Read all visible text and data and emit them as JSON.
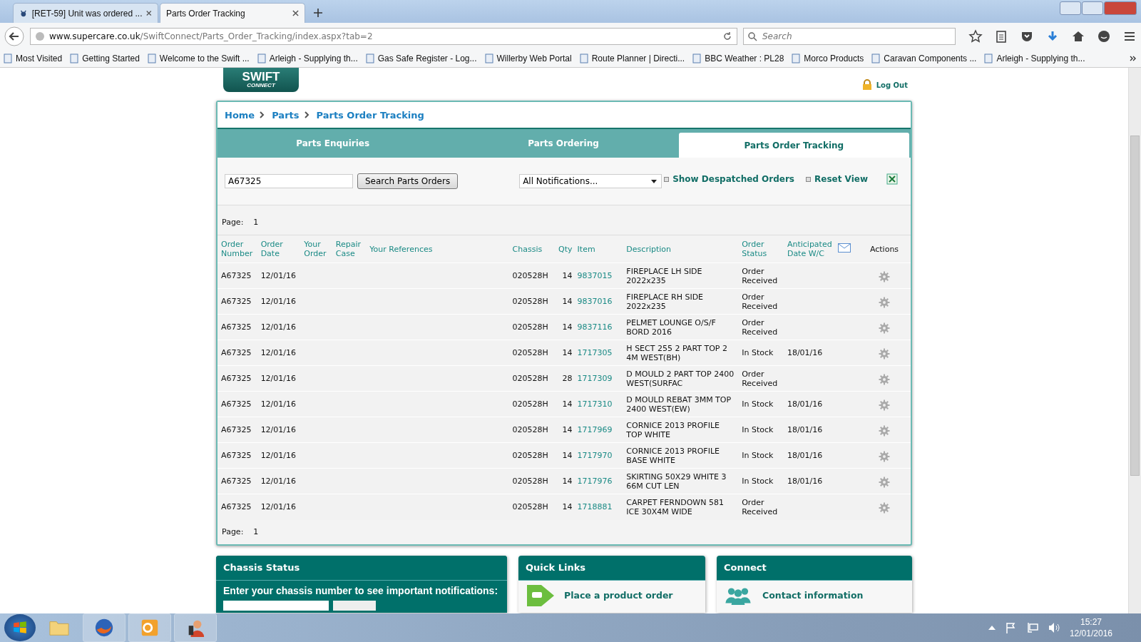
{
  "browser": {
    "tabs": [
      {
        "title": "[RET-59] Unit was ordered ...",
        "selected": false
      },
      {
        "title": "Parts Order Tracking",
        "selected": true
      }
    ],
    "url_domain": "www.supercare.co.uk",
    "url_path": "/SwiftConnect/Parts_Order_Tracking/index.aspx?tab=2",
    "search": {
      "placeholder": "Search"
    },
    "bookmarks": [
      "Most Visited",
      "Getting Started",
      "Welcome to the Swift ...",
      "Arleigh - Supplying th...",
      "Gas Safe Register - Log...",
      "Willerby Web Portal",
      "Route Planner | Directi...",
      "BBC Weather : PL28",
      "Morco Products",
      "Caravan Components ...",
      "Arleigh - Supplying th..."
    ]
  },
  "header": {
    "logo_line_1": "SWIFT",
    "logo_line_2": "CONNECT",
    "logout": "Log Out"
  },
  "breadcrumb": [
    "Home",
    "Parts",
    "Parts Order Tracking"
  ],
  "tabs": [
    {
      "label": "Parts Enquiries",
      "selected": false
    },
    {
      "label": "Parts Ordering",
      "selected": false
    },
    {
      "label": "Parts Order Tracking",
      "selected": true
    }
  ],
  "toolbar": {
    "search_value": "A67325",
    "search_button": "Search Parts Orders",
    "notifications": "All Notifications...",
    "links": [
      "Show Despatched Orders",
      "Reset View"
    ]
  },
  "page_label": "Page:",
  "page_number": "1",
  "table": {
    "columns": [
      "Order Number",
      "Order Date",
      "Your Order",
      "Repair Case",
      "Your References",
      "Chassis",
      "Qty",
      "Item",
      "Description",
      "Order Status",
      "Anticipated Date W/C",
      "Actions"
    ],
    "rows": [
      {
        "order": "A67325",
        "date": "12/01/16",
        "chassis": "020528H",
        "qty": "14",
        "item": "9837015",
        "description": "FIREPLACE LH SIDE 2022x235",
        "status": "Order Received",
        "anticipated": ""
      },
      {
        "order": "A67325",
        "date": "12/01/16",
        "chassis": "020528H",
        "qty": "14",
        "item": "9837016",
        "description": "FIREPLACE RH SIDE 2022x235",
        "status": "Order Received",
        "anticipated": ""
      },
      {
        "order": "A67325",
        "date": "12/01/16",
        "chassis": "020528H",
        "qty": "14",
        "item": "9837116",
        "description": "PELMET LOUNGE O/S/F BORD 2016",
        "status": "Order Received",
        "anticipated": ""
      },
      {
        "order": "A67325",
        "date": "12/01/16",
        "chassis": "020528H",
        "qty": "14",
        "item": "1717305",
        "description": "H SECT 255 2 PART TOP 2 4M WEST(BH)",
        "status": "In Stock",
        "anticipated": "18/01/16"
      },
      {
        "order": "A67325",
        "date": "12/01/16",
        "chassis": "020528H",
        "qty": "28",
        "item": "1717309",
        "description": "D MOULD 2 PART TOP 2400 WEST(SURFAC",
        "status": "Order Received",
        "anticipated": ""
      },
      {
        "order": "A67325",
        "date": "12/01/16",
        "chassis": "020528H",
        "qty": "14",
        "item": "1717310",
        "description": "D MOULD REBAT 3MM TOP 2400 WEST(EW)",
        "status": "In Stock",
        "anticipated": "18/01/16"
      },
      {
        "order": "A67325",
        "date": "12/01/16",
        "chassis": "020528H",
        "qty": "14",
        "item": "1717969",
        "description": "CORNICE 2013 PROFILE TOP WHITE",
        "status": "In Stock",
        "anticipated": "18/01/16"
      },
      {
        "order": "A67325",
        "date": "12/01/16",
        "chassis": "020528H",
        "qty": "14",
        "item": "1717970",
        "description": "CORNICE 2013 PROFILE BASE WHITE",
        "status": "In Stock",
        "anticipated": "18/01/16"
      },
      {
        "order": "A67325",
        "date": "12/01/16",
        "chassis": "020528H",
        "qty": "14",
        "item": "1717976",
        "description": "SKIRTING 50X29 WHITE 3 66M CUT LEN",
        "status": "In Stock",
        "anticipated": "18/01/16"
      },
      {
        "order": "A67325",
        "date": "12/01/16",
        "chassis": "020528H",
        "qty": "14",
        "item": "1718881",
        "description": "CARPET FERNDOWN 581 ICE 30X4M WIDE",
        "status": "Order Received",
        "anticipated": ""
      }
    ]
  },
  "footer_page_label": "Page:",
  "footer_page_number": "1",
  "panels": [
    {
      "kind": "chassis",
      "title": "Chassis Status",
      "text": "Enter your chassis number to see important notifications:"
    },
    {
      "kind": "links",
      "title": "Quick Links",
      "text": "Place a product order"
    },
    {
      "kind": "connect",
      "title": "Connect",
      "text": "Contact information"
    }
  ],
  "taskbar": {
    "time": "15:27",
    "date": "12/01/2016"
  }
}
